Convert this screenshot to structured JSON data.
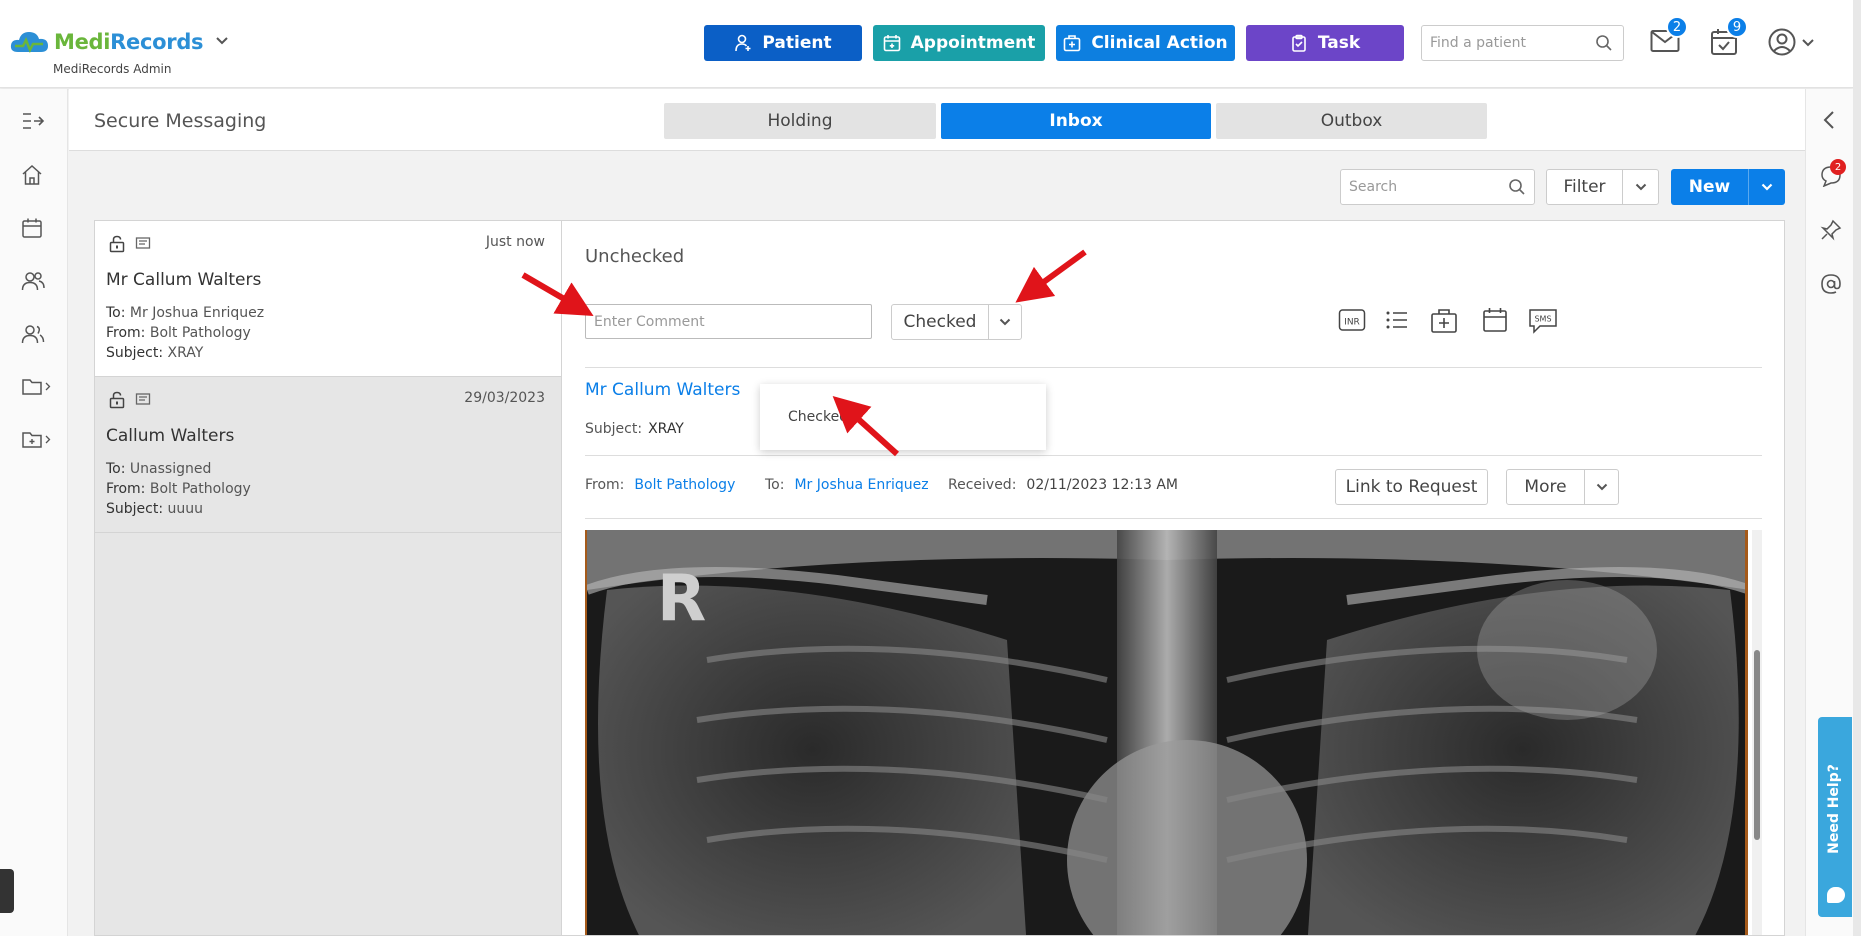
{
  "header": {
    "logo_text_a": "Medi",
    "logo_text_b": "Records",
    "admin_label": "MediRecords Admin",
    "buttons": {
      "patient": "Patient",
      "appointment": "Appointment",
      "clinical_action": "Clinical Action",
      "task": "Task"
    },
    "find_placeholder": "Find a patient",
    "mail_badge": "2",
    "tasks_badge": "9"
  },
  "page": {
    "title": "Secure Messaging",
    "tabs": {
      "holding": "Holding",
      "inbox": "Inbox",
      "outbox": "Outbox"
    },
    "search_placeholder": "Search",
    "filter_label": "Filter",
    "new_label": "New"
  },
  "messages": [
    {
      "time": "Just now",
      "name": "Mr Callum Walters",
      "to_label": "To:",
      "to": "Mr Joshua Enriquez",
      "from_label": "From:",
      "from": "Bolt Pathology",
      "subject_label": "Subject:",
      "subject": "XRAY"
    },
    {
      "time": "29/03/2023",
      "name": "Callum Walters",
      "to_label": "To:",
      "to": "Unassigned",
      "from_label": "From:",
      "from": "Bolt Pathology",
      "subject_label": "Subject:",
      "subject": "uuuu"
    }
  ],
  "detail": {
    "status": "Unchecked",
    "comment_placeholder": "Enter Comment",
    "checked_label": "Checked",
    "dropdown_option": "Checked",
    "sender_name": "Mr Callum Walters",
    "subject_label": "Subject:",
    "subject": "XRAY",
    "from_label": "From:",
    "from": "Bolt Pathology",
    "to_label": "To:",
    "to": "Mr Joshua Enriquez",
    "received_label": "Received:",
    "received": "02/11/2023 12:13 AM",
    "link_to_request": "Link to Request",
    "more_label": "More",
    "tool_inr": "INR",
    "tool_sms": "SMS"
  },
  "right_sidebar": {
    "chat_badge": "2",
    "need_help": "Need Help?"
  },
  "colors": {
    "patient": "#0b5fc6",
    "appointment": "#1aa0a8",
    "clinical_action": "#0d7fe0",
    "task": "#6c45c8",
    "primary": "#0b7fe8",
    "annotation_arrow": "#e0141a"
  }
}
